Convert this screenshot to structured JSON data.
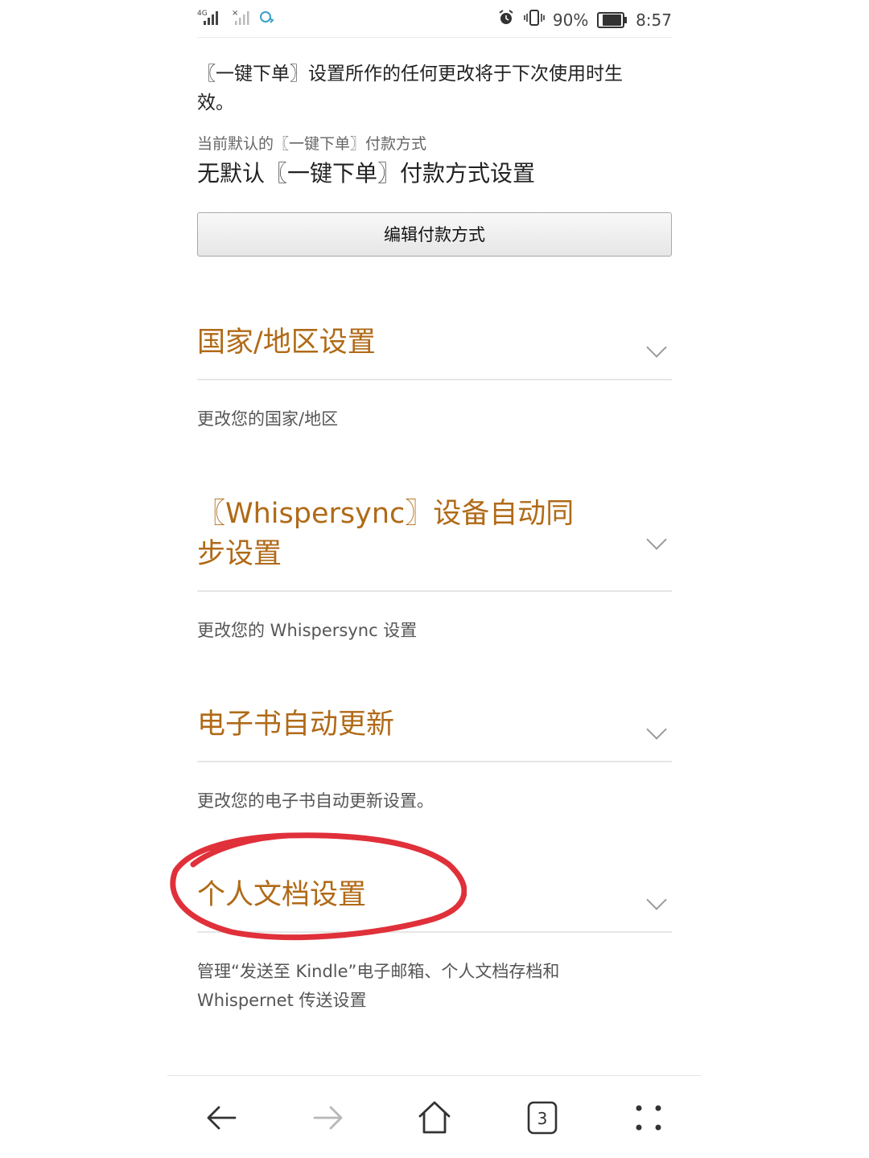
{
  "status_bar": {
    "signal_primary": "4G",
    "battery": "90%",
    "battery_level": 0.9,
    "time": "8:57"
  },
  "one_click": {
    "note": "〖一键下单〗设置所作的任何更改将于下次使用时生效。",
    "current_label": "当前默认的〖一键下单〗付款方式",
    "current_value": "无默认〖一键下单〗付款方式设置",
    "edit_button": "编辑付款方式"
  },
  "sections": [
    {
      "title": "国家/地区设置",
      "desc": "更改您的国家/地区"
    },
    {
      "title": "〖Whispersync〗设备自动同步设置",
      "desc": "更改您的 Whispersync 设置"
    },
    {
      "title": "电子书自动更新",
      "desc": "更改您的电子书自动更新设置。"
    },
    {
      "title": "个人文档设置",
      "desc": "管理“发送至 Kindle”电子邮箱、个人文档存档和 Whispernet 传送设置"
    }
  ],
  "annotation": {
    "color": "#e0303a"
  },
  "colors": {
    "section_title": "#b06a17"
  },
  "bottom_nav": {
    "back_icon": "arrow-left-icon",
    "forward_icon": "arrow-right-icon",
    "home_icon": "home-icon",
    "tabs_count": "3",
    "menu_icon": "four-dots-icon"
  }
}
